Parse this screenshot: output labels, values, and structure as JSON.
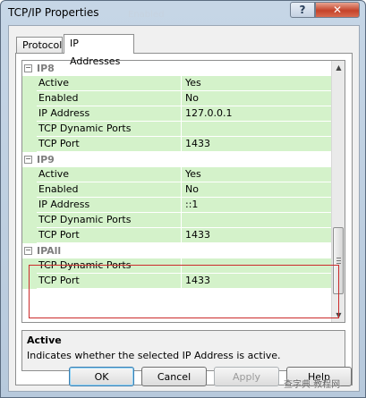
{
  "window": {
    "title": "TCP/IP Properties",
    "ghost_title": "Enabled",
    "help_glyph": "?",
    "close_glyph": "✕"
  },
  "tabs": [
    {
      "label": "Protocol",
      "active": false
    },
    {
      "label": "IP Addresses",
      "active": true
    }
  ],
  "grid": {
    "groups": [
      {
        "name": "IP8",
        "expander": "−",
        "properties": [
          {
            "name": "Active",
            "value": "Yes"
          },
          {
            "name": "Enabled",
            "value": "No"
          },
          {
            "name": "IP Address",
            "value": "127.0.0.1"
          },
          {
            "name": "TCP Dynamic Ports",
            "value": ""
          },
          {
            "name": "TCP Port",
            "value": "1433"
          }
        ]
      },
      {
        "name": "IP9",
        "expander": "−",
        "properties": [
          {
            "name": "Active",
            "value": "Yes"
          },
          {
            "name": "Enabled",
            "value": "No"
          },
          {
            "name": "IP Address",
            "value": "::1"
          },
          {
            "name": "TCP Dynamic Ports",
            "value": ""
          },
          {
            "name": "TCP Port",
            "value": "1433"
          }
        ]
      },
      {
        "name": "IPAll",
        "expander": "−",
        "properties": [
          {
            "name": "TCP Dynamic Ports",
            "value": ""
          },
          {
            "name": "TCP Port",
            "value": "1433"
          }
        ]
      }
    ],
    "scroll_up_glyph": "▲",
    "scroll_down_glyph": "▼",
    "highlight_color": "#cc2b2b",
    "row_color": "#d4f2ca"
  },
  "description": {
    "title": "Active",
    "text": "Indicates whether the selected IP Address is active."
  },
  "buttons": {
    "ok": "OK",
    "cancel": "Cancel",
    "apply": "Apply",
    "help": "Help"
  },
  "watermark": "查字典 教程网"
}
